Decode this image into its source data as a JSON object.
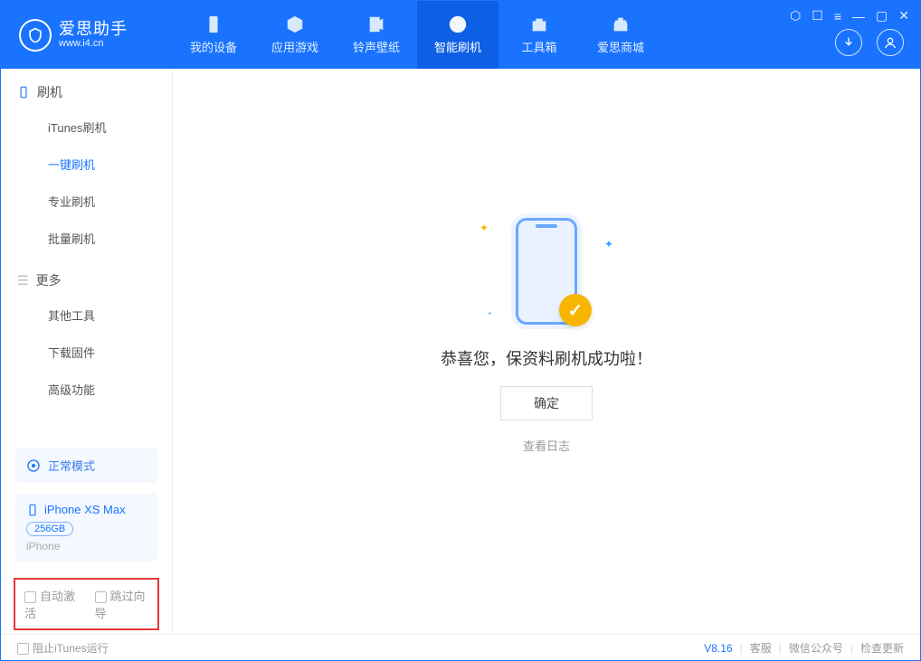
{
  "app": {
    "title": "爱思助手",
    "subtitle": "www.i4.cn"
  },
  "nav": {
    "device": "我的设备",
    "apps": "应用游戏",
    "ringtones": "铃声壁纸",
    "flash": "智能刷机",
    "toolbox": "工具箱",
    "store": "爱思商城"
  },
  "sidebar": {
    "section_flash": "刷机",
    "items_flash": {
      "itunes": "iTunes刷机",
      "oneclick": "一键刷机",
      "pro": "专业刷机",
      "batch": "批量刷机"
    },
    "section_more": "更多",
    "items_more": {
      "other": "其他工具",
      "firmware": "下载固件",
      "advanced": "高级功能"
    }
  },
  "mode": {
    "label": "正常模式"
  },
  "device": {
    "name": "iPhone XS Max",
    "storage": "256GB",
    "type": "iPhone"
  },
  "options": {
    "auto_activate": "自动激活",
    "skip_guide": "跳过向导"
  },
  "main": {
    "success": "恭喜您，保资料刷机成功啦！",
    "ok": "确定",
    "log": "查看日志"
  },
  "footer": {
    "block_itunes": "阻止iTunes运行",
    "version": "V8.16",
    "support": "客服",
    "wechat": "微信公众号",
    "update": "检查更新"
  }
}
